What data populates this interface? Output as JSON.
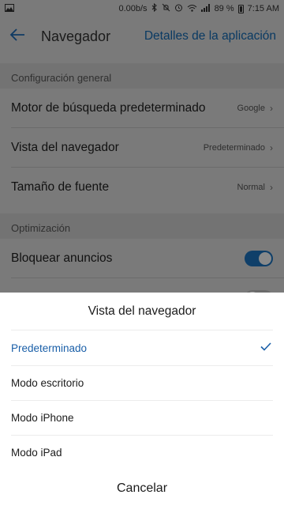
{
  "status_bar": {
    "speed": "0.00b/s",
    "battery": "89 %",
    "time": "7:15 AM",
    "icons": [
      "gallery-icon",
      "bluetooth-icon",
      "mute-icon",
      "alarm-icon",
      "wifi-icon",
      "signal-icon",
      "battery-icon"
    ]
  },
  "header": {
    "title": "Navegador",
    "details_link": "Detalles de la aplicación",
    "accent": "#1a5fa8"
  },
  "sections": {
    "general": "Configuración general",
    "optimization": "Optimización"
  },
  "settings": {
    "search_engine": {
      "label": "Motor de búsqueda predeterminado",
      "value": "Google"
    },
    "browser_view": {
      "label": "Vista del navegador",
      "value": "Predeterminado"
    },
    "font_size": {
      "label": "Tamaño de fuente",
      "value": "Normal"
    },
    "block_ads": {
      "label": "Bloquear anuncios",
      "enabled": true
    }
  },
  "sheet": {
    "title": "Vista del navegador",
    "options": [
      {
        "label": "Predeterminado",
        "selected": true
      },
      {
        "label": "Modo escritorio",
        "selected": false
      },
      {
        "label": "Modo iPhone",
        "selected": false
      },
      {
        "label": "Modo iPad",
        "selected": false
      }
    ],
    "cancel": "Cancelar"
  }
}
